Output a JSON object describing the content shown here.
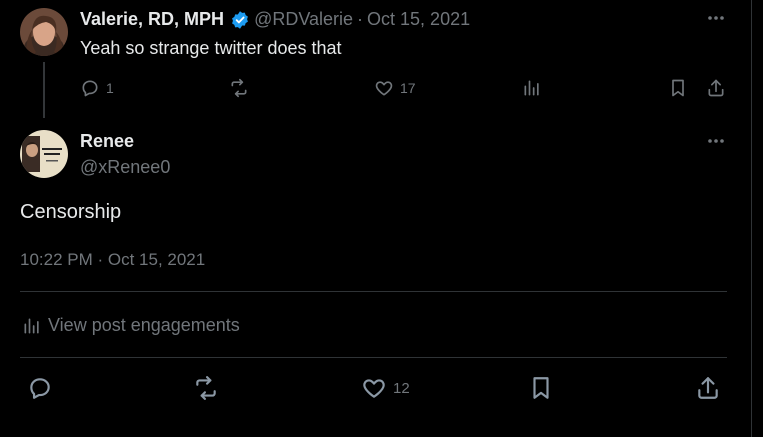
{
  "reply_tweet": {
    "author_name": "Valerie, RD, MPH",
    "handle": "@RDValerie",
    "separator": "·",
    "date": "Oct 15, 2021",
    "text": "Yeah so strange twitter does that",
    "counts": {
      "replies": "1",
      "reposts": "",
      "likes": "17"
    },
    "verified": true
  },
  "main_tweet": {
    "author_name": "Renee",
    "handle": "@xRenee0",
    "text": "Censorship",
    "timestamp": "10:22 PM · Oct 15, 2021",
    "engagements_label": "View post engagements",
    "counts": {
      "likes": "12"
    }
  },
  "colors": {
    "background": "#000000",
    "text": "#e7e9ea",
    "muted": "#71767b",
    "verified": "#1d9bf0",
    "divider": "#2f3336"
  },
  "icons": [
    "more-icon",
    "reply-icon",
    "repost-icon",
    "like-icon",
    "views-icon",
    "bookmark-icon",
    "share-icon",
    "verified-badge-icon"
  ]
}
